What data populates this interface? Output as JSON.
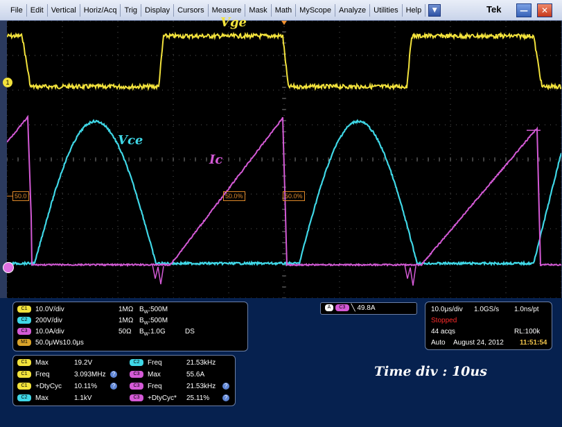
{
  "menu": {
    "items": [
      "File",
      "Edit",
      "Vertical",
      "Horiz/Acq",
      "Trig",
      "Display",
      "Cursors",
      "Measure",
      "Mask",
      "Math",
      "MyScope",
      "Analyze",
      "Utilities",
      "Help"
    ],
    "brand": "Tek"
  },
  "screen": {
    "labels": {
      "vge": "Vge",
      "vce": "Vce",
      "ic": "Ic"
    },
    "level_markers": [
      "50.0",
      "50.0%",
      "50.0%"
    ],
    "ground_marker": "1",
    "colors": {
      "ch1": "#f2e23c",
      "ch2": "#3fd7e6",
      "ch3": "#d45ad6",
      "trigger": "#f09030",
      "grid": "#5a5a5a"
    }
  },
  "channels": {
    "rows": [
      {
        "chip": "C1",
        "scale": "10.0V/div",
        "imp": "1MΩ",
        "bw": "500M",
        "extra": ""
      },
      {
        "chip": "C2",
        "scale": "200V/div",
        "imp": "1MΩ",
        "bw": "500M",
        "extra": ""
      },
      {
        "chip": "C3",
        "scale": "10.0A/div",
        "imp": "50Ω",
        "bw": "1.0G",
        "extra": "DS"
      },
      {
        "chip": "M1",
        "scale": "50.0μWs10.0μs",
        "imp": "",
        "bw": "",
        "extra": ""
      }
    ],
    "bw_prefix": "B",
    "bw_sub": "W",
    "bw_sep": ":"
  },
  "trigger": {
    "chip_a": "A",
    "chip_ch": "C3",
    "level": "49.8A"
  },
  "acq": {
    "timebase": "10.0μs/div",
    "sample_rate": "1.0GS/s",
    "resolution": "1.0ns/pt",
    "state": "Stopped",
    "acqs": "44 acqs",
    "record": "RL:100k",
    "mode": "Auto",
    "date": "August 24, 2012",
    "time": "11:51:54"
  },
  "measurements": {
    "left": [
      {
        "chip": "C1",
        "name": "Max",
        "value": "19.2V",
        "help": false
      },
      {
        "chip": "C1",
        "name": "Freq",
        "value": "3.093MHz",
        "help": true
      },
      {
        "chip": "C1",
        "name": "+DtyCyc",
        "value": "10.11%",
        "help": true
      },
      {
        "chip": "C2",
        "name": "Max",
        "value": "1.1kV",
        "help": false
      }
    ],
    "right": [
      {
        "chip": "C2",
        "name": "Freq",
        "value": "21.53kHz",
        "help": false
      },
      {
        "chip": "C3",
        "name": "Max",
        "value": "55.6A",
        "help": false
      },
      {
        "chip": "C3",
        "name": "Freq",
        "value": "21.53kHz",
        "help": true
      },
      {
        "chip": "C3",
        "name": "+DtyCyc*",
        "value": "25.11%",
        "help": true
      }
    ]
  },
  "annotation": "Time div : 10us"
}
